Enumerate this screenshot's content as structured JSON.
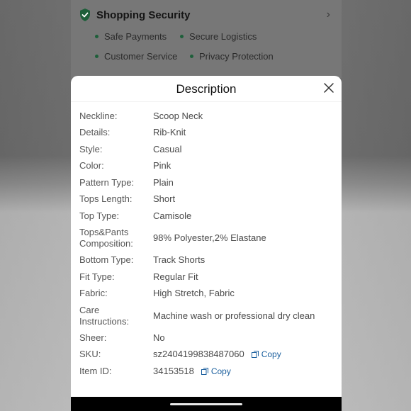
{
  "security": {
    "title": "Shopping Security",
    "items": [
      "Safe Payments",
      "Secure Logistics",
      "Customer Service",
      "Privacy Protection"
    ]
  },
  "modal": {
    "title": "Description",
    "rows": [
      {
        "label": "Neckline:",
        "value": "Scoop Neck"
      },
      {
        "label": "Details:",
        "value": "Rib-Knit"
      },
      {
        "label": "Style:",
        "value": "Casual"
      },
      {
        "label": "Color:",
        "value": "Pink"
      },
      {
        "label": "Pattern Type:",
        "value": "Plain"
      },
      {
        "label": "Tops Length:",
        "value": "Short"
      },
      {
        "label": "Top Type:",
        "value": "Camisole"
      },
      {
        "label": "Tops&Pants Composition:",
        "value": "98% Polyester,2% Elastane"
      },
      {
        "label": "Bottom Type:",
        "value": "Track Shorts"
      },
      {
        "label": "Fit Type:",
        "value": "Regular Fit"
      },
      {
        "label": "Fabric:",
        "value": "High Stretch, Fabric"
      },
      {
        "label": "Care Instructions:",
        "value": "Machine wash or professional dry clean"
      },
      {
        "label": "Sheer:",
        "value": "No"
      },
      {
        "label": "SKU:",
        "value": "sz2404199838487060"
      },
      {
        "label": "Item ID:",
        "value": "34153518"
      }
    ],
    "copy_label": "Copy"
  },
  "colors": {
    "accent_green": "#1e5f3a",
    "link_blue": "#1b5f9e"
  }
}
